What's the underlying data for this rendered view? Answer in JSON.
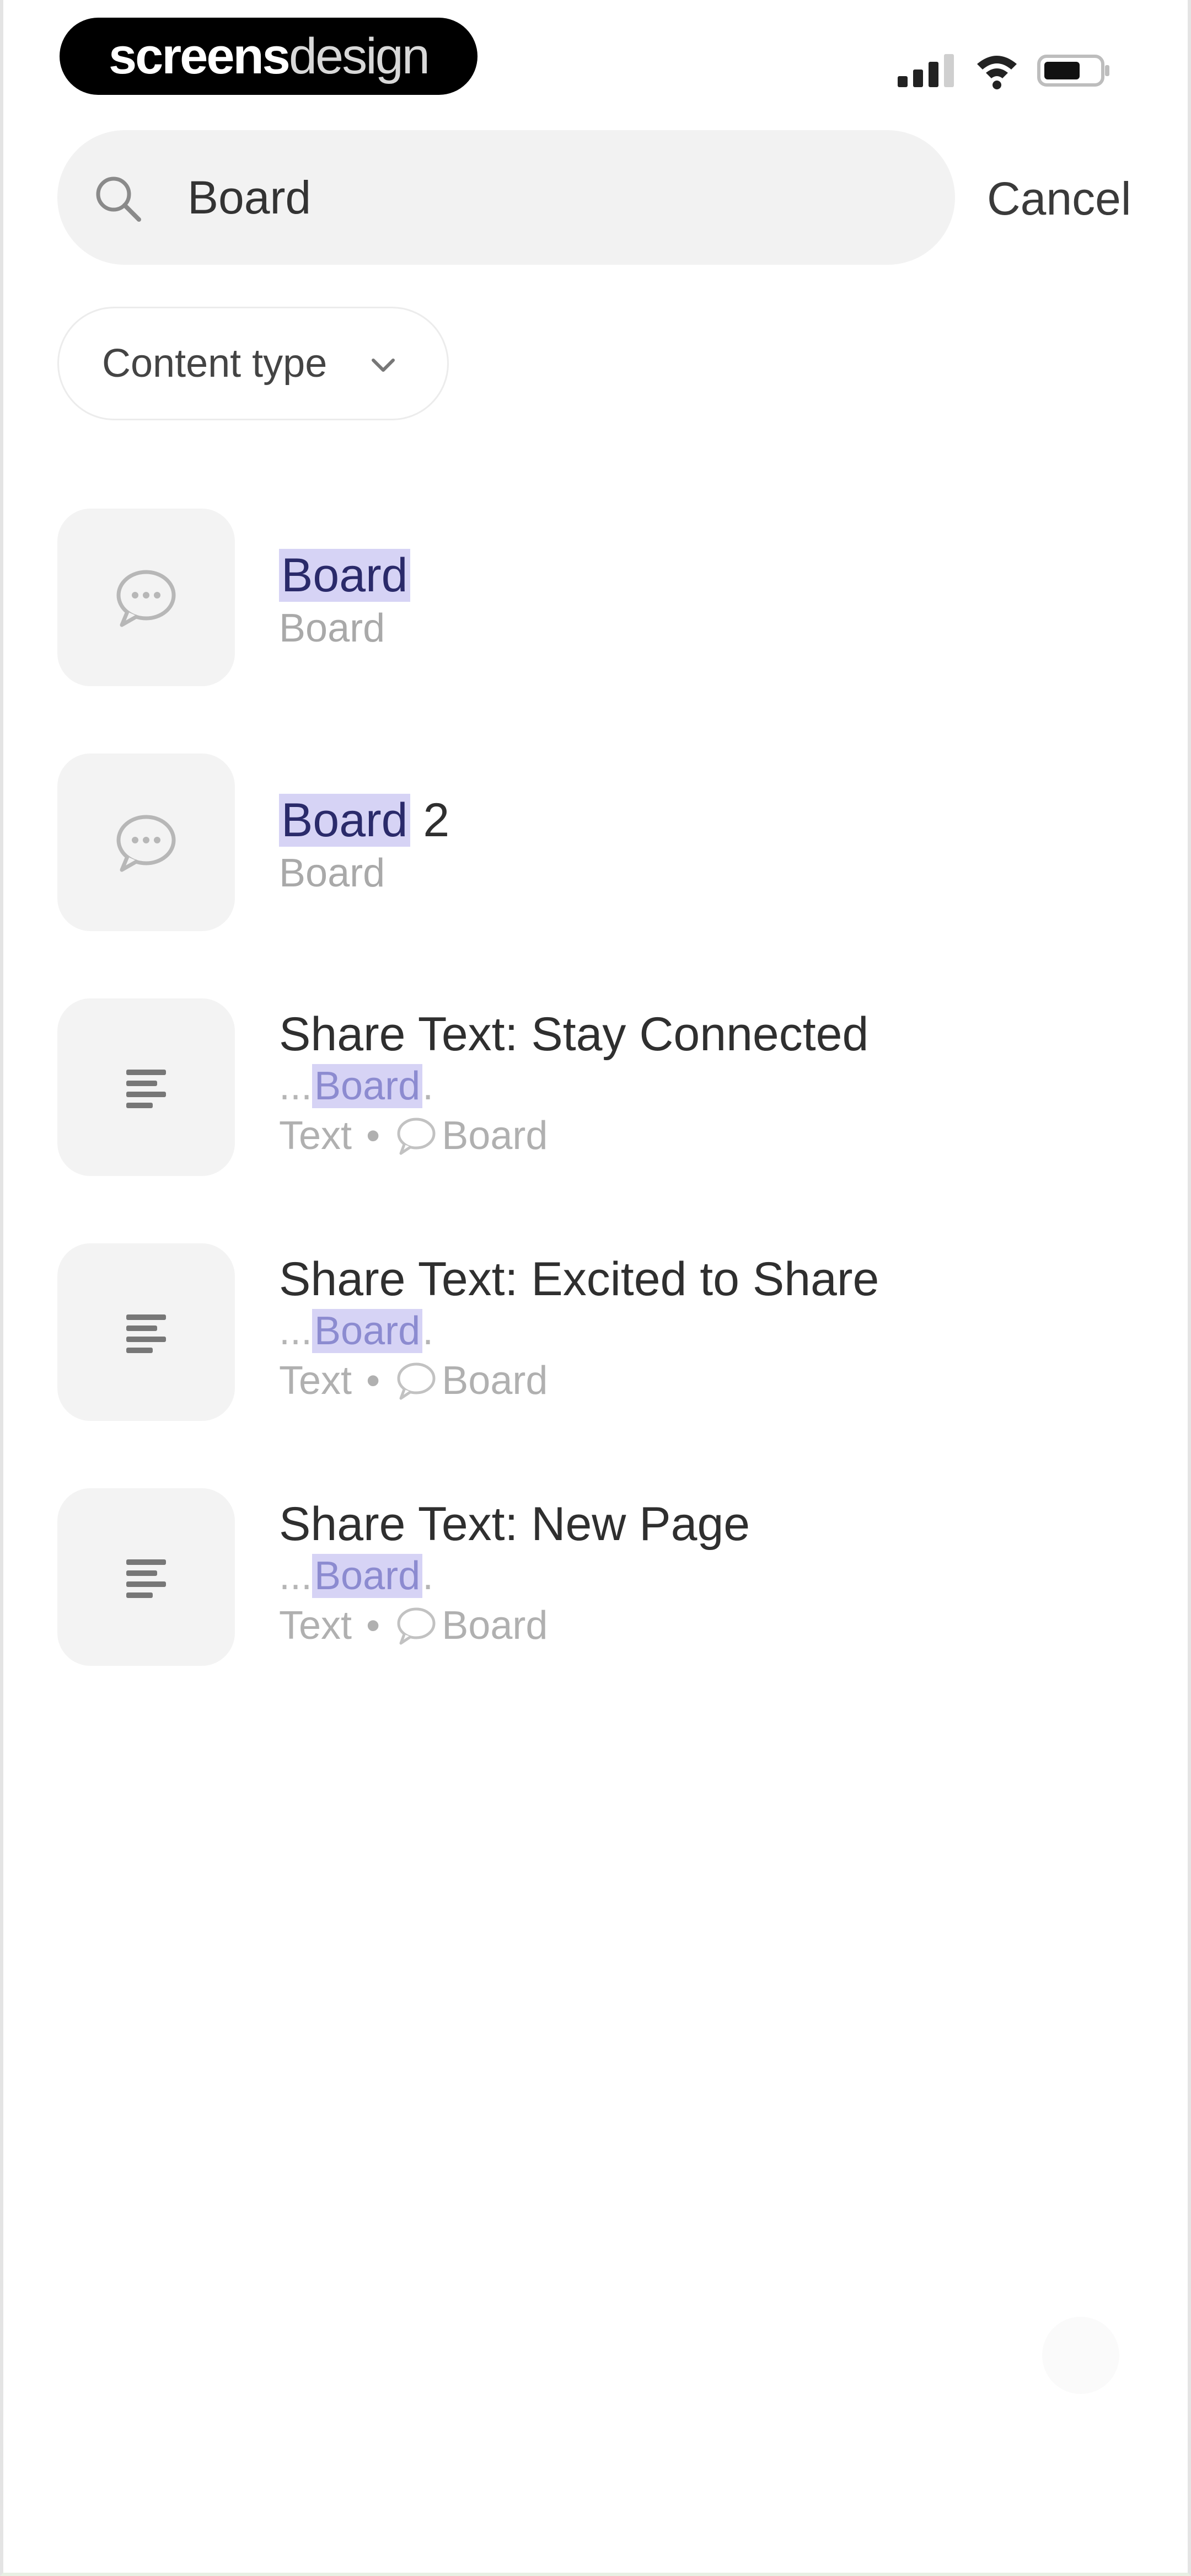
{
  "status_bar": {
    "logo": {
      "part1": "screens",
      "part2": "design"
    }
  },
  "search": {
    "value": "Board",
    "cancel_label": "Cancel"
  },
  "filter": {
    "chip_label": "Content type"
  },
  "results": [
    {
      "icon": "comment-icon",
      "title_hl": "Board",
      "title_rest": "",
      "subtitle": "Board"
    },
    {
      "icon": "comment-icon",
      "title_hl": "Board",
      "title_rest": " 2",
      "subtitle": "Board"
    },
    {
      "icon": "text-lines-icon",
      "title": "Share Text: Stay Connected",
      "snippet_prefix": "...",
      "snippet_hl": "Board",
      "snippet_suffix": ".",
      "type_label": "Text",
      "parent_label": "Board"
    },
    {
      "icon": "text-lines-icon",
      "title": "Share Text: Excited to Share",
      "snippet_prefix": "...",
      "snippet_hl": "Board",
      "snippet_suffix": ".",
      "type_label": "Text",
      "parent_label": "Board"
    },
    {
      "icon": "text-lines-icon",
      "title": "Share Text: New Page",
      "snippet_prefix": "...",
      "snippet_hl": "Board",
      "snippet_suffix": ".",
      "type_label": "Text",
      "parent_label": "Board"
    }
  ],
  "colors": {
    "highlight": "#d6d3f5",
    "thumb_bg": "#f3f3f3",
    "search_bg": "#f2f2f2"
  }
}
